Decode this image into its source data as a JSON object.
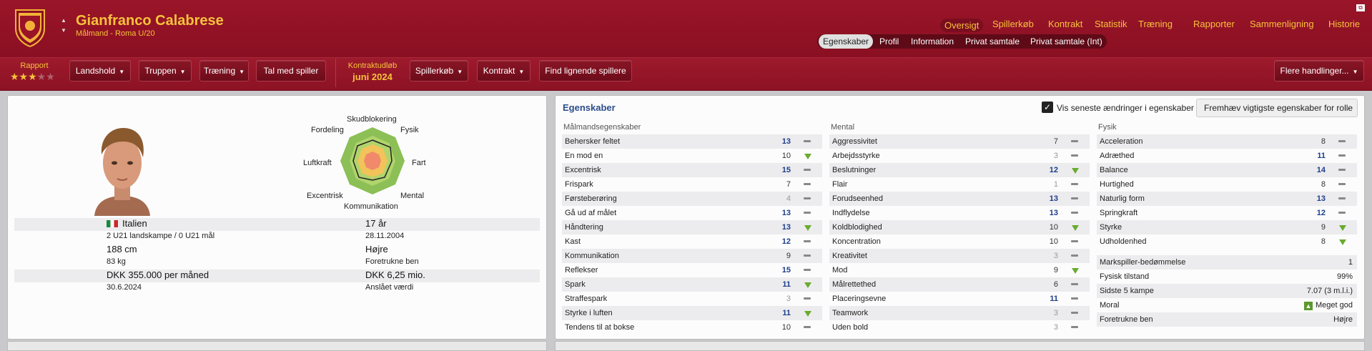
{
  "player": {
    "name": "Gianfranco Calabrese",
    "subtitle": "Målmand - Roma U/20"
  },
  "nav": {
    "items": [
      "Oversigt",
      "Spillerkøb",
      "Kontrakt",
      "Statistik",
      "Træning",
      "Rapporter",
      "Sammenligning",
      "Historie"
    ],
    "active": "Oversigt"
  },
  "subtabs": {
    "items": [
      "Egenskaber",
      "Profil",
      "Information",
      "Privat samtale",
      "Privat samtale (Int)"
    ],
    "active": "Egenskaber"
  },
  "toolbar": {
    "report_label": "Rapport",
    "stars_filled": 3,
    "stars_total": 5,
    "buttons": [
      "Landshold",
      "Truppen",
      "Træning",
      "Tal med spiller"
    ],
    "contract_label": "Kontraktudløb",
    "contract_value": "juni 2024",
    "buttons2": [
      "Spillerkøb",
      "Kontrakt",
      "Find lignende spillere"
    ],
    "more_actions": "Flere handlinger..."
  },
  "info": {
    "nationality": "Italien",
    "caps": "2 U21 landskampe / 0 U21 mål",
    "age": "17 år",
    "dob": "28.11.2004",
    "height": "188 cm",
    "weight": "83 kg",
    "foot": "Højre",
    "foot_label": "Foretrukne ben",
    "wage": "DKK 355.000 per måned",
    "contract_end": "30.6.2024",
    "value": "DKK 6,25 mio.",
    "value_label": "Anslået værdi"
  },
  "radar": {
    "labels": [
      "Skudblokering",
      "Fysik",
      "Fart",
      "Mental",
      "Kommunikation",
      "Excentrisk",
      "Luftkraft",
      "Fordeling"
    ]
  },
  "attributes": {
    "title": "Egenskaber",
    "show_changes_label": "Vis seneste ændringer i egenskaber",
    "highlight_dropdown": "Fremhæv vigtigste egenskaber for rolle",
    "gk_title": "Målmandsegenskaber",
    "gk": [
      {
        "name": "Behersker feltet",
        "value": "13",
        "trend": "flat"
      },
      {
        "name": "En mod en",
        "value": "10",
        "trend": "up"
      },
      {
        "name": "Excentrisk",
        "value": "15",
        "trend": "flat"
      },
      {
        "name": "Frispark",
        "value": "7",
        "trend": "flat"
      },
      {
        "name": "Førsteberøring",
        "value": "4",
        "trend": "flat"
      },
      {
        "name": "Gå ud af målet",
        "value": "13",
        "trend": "flat"
      },
      {
        "name": "Håndtering",
        "value": "13",
        "trend": "up"
      },
      {
        "name": "Kast",
        "value": "12",
        "trend": "flat"
      },
      {
        "name": "Kommunikation",
        "value": "9",
        "trend": "flat"
      },
      {
        "name": "Reflekser",
        "value": "15",
        "trend": "flat"
      },
      {
        "name": "Spark",
        "value": "11",
        "trend": "up"
      },
      {
        "name": "Straffespark",
        "value": "3",
        "trend": "flat"
      },
      {
        "name": "Styrke i luften",
        "value": "11",
        "trend": "up"
      },
      {
        "name": "Tendens til at bokse",
        "value": "10",
        "trend": "flat"
      }
    ],
    "mental_title": "Mental",
    "mental": [
      {
        "name": "Aggressivitet",
        "value": "7",
        "trend": "flat"
      },
      {
        "name": "Arbejdsstyrke",
        "value": "3",
        "trend": "flat"
      },
      {
        "name": "Beslutninger",
        "value": "12",
        "trend": "up"
      },
      {
        "name": "Flair",
        "value": "1",
        "trend": "flat"
      },
      {
        "name": "Forudseenhed",
        "value": "13",
        "trend": "flat"
      },
      {
        "name": "Indflydelse",
        "value": "13",
        "trend": "flat"
      },
      {
        "name": "Koldblodighed",
        "value": "10",
        "trend": "up"
      },
      {
        "name": "Koncentration",
        "value": "10",
        "trend": "flat"
      },
      {
        "name": "Kreativitet",
        "value": "3",
        "trend": "flat"
      },
      {
        "name": "Mod",
        "value": "9",
        "trend": "up"
      },
      {
        "name": "Målrettethed",
        "value": "6",
        "trend": "flat"
      },
      {
        "name": "Placeringsevne",
        "value": "11",
        "trend": "flat"
      },
      {
        "name": "Teamwork",
        "value": "3",
        "trend": "flat"
      },
      {
        "name": "Uden bold",
        "value": "3",
        "trend": "flat"
      }
    ],
    "physical_title": "Fysik",
    "physical": [
      {
        "name": "Acceleration",
        "value": "8",
        "trend": "flat"
      },
      {
        "name": "Adræthed",
        "value": "11",
        "trend": "flat"
      },
      {
        "name": "Balance",
        "value": "14",
        "trend": "flat"
      },
      {
        "name": "Hurtighed",
        "value": "8",
        "trend": "flat"
      },
      {
        "name": "Naturlig form",
        "value": "13",
        "trend": "flat"
      },
      {
        "name": "Springkraft",
        "value": "12",
        "trend": "flat"
      },
      {
        "name": "Styrke",
        "value": "9",
        "trend": "up"
      },
      {
        "name": "Udholdenhed",
        "value": "8",
        "trend": "up"
      }
    ],
    "stats": [
      {
        "name": "Markspiller-bedømmelse",
        "value": "1"
      },
      {
        "name": "Fysisk tilstand",
        "value": "99%"
      },
      {
        "name": "Sidste 5 kampe",
        "value": "7.07 (3 m.l.i.)"
      },
      {
        "name": "Moral",
        "value": "Meget god"
      },
      {
        "name": "Foretrukne ben",
        "value": "Højre"
      }
    ]
  }
}
